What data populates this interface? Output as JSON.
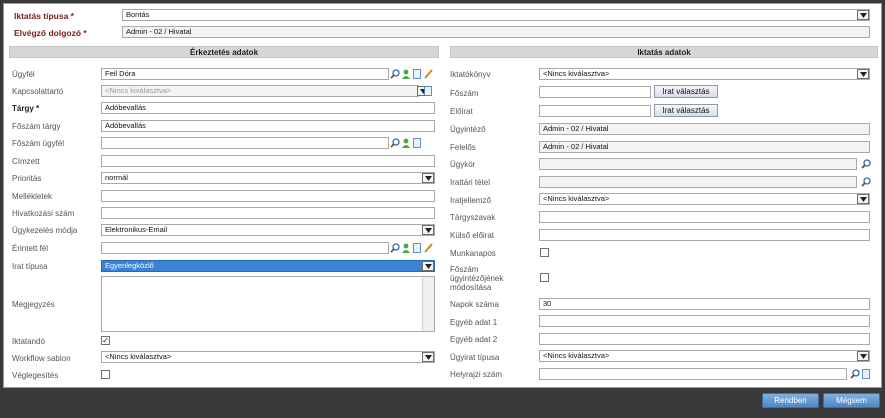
{
  "top": {
    "iktatas_tipusa_label": "Iktatás típusa *",
    "iktatas_tipusa_value": "Bontás",
    "elvegzo_label": "Elvégző dolgozó *",
    "elvegzo_value": "Admin - 02 / Hivatal"
  },
  "left": {
    "header": "Érkeztetés adatok",
    "ugyfel_label": "Ügyfél",
    "ugyfel_value": "Feil Dóra",
    "kapcsolattarto_label": "Kapcsolattartó",
    "kapcsolattarto_placeholder": "<Nincs kiválasztva>",
    "targy_label": "Tárgy *",
    "targy_value": "Adóbevallás",
    "foszam_targy_label": "Főszám tárgy",
    "foszam_targy_value": "Adóbevallás",
    "foszam_ugyfel_label": "Főszám ügyfél",
    "foszam_ugyfel_value": "",
    "cimzett_label": "Címzett",
    "cimzett_value": "",
    "prioritas_label": "Prioritás",
    "prioritas_value": "normál",
    "mellekletek_label": "Mellékletek",
    "hivatkozasi_label": "Hivatkozási szám",
    "ugykezeles_label": "Ügykezelés módja",
    "ugykezeles_value": "Elektronikus-Email",
    "erintett_label": "Érintett fél",
    "erintett_value": "",
    "irat_tipusa_label": "Irat típusa",
    "irat_tipusa_value": "Egyenlegközlő",
    "megjegyzes_label": "Megjegyzés",
    "iktatando_label": "Iktatandó",
    "iktatando_checked": "✓",
    "workflow_label": "Workflow sablon",
    "workflow_value": "<Nincs kiválasztva>",
    "veglegesites_label": "Véglegesítés"
  },
  "right": {
    "header": "Iktatás adatok",
    "iktatokonyv_label": "Iktatókönyv",
    "iktatokonyv_value": "<Nincs kiválasztva>",
    "foszam_label": "Főszám",
    "foszam_button": "Irat választás",
    "eloirat_label": "Előirat",
    "eloirat_button": "Irat választás",
    "ugyintezo_label": "Ügyintéző",
    "ugyintezo_value": "Admin - 02 / Hivatal",
    "felelos_label": "Felelős",
    "felelos_value": "Admin - 02 / Hivatal",
    "ugykor_label": "Ügykör",
    "irattari_label": "Irattári tétel",
    "iratjellemzo_label": "Iratjellemző",
    "iratjellemzo_value": "<Nincs kiválasztva>",
    "targyszavak_label": "Tárgyszavak",
    "kulso_eloirat_label": "Külső előirat",
    "munkanapos_label": "Munkanapos",
    "foszam_mod_label_1": "Főszám",
    "foszam_mod_label_2": "ügyintézőjének",
    "foszam_mod_label_3": "módosítása",
    "napok_label": "Napok száma",
    "napok_value": "30",
    "egyeb1_label": "Egyéb adat 1",
    "egyeb2_label": "Egyéb adat 2",
    "ugyirat_tipusa_label": "Ügyirat típusa",
    "ugyirat_tipusa_value": "<Nincs kiválasztva>",
    "helyrajzi_label": "Helyrajzi szám"
  },
  "footer": {
    "ok_label": "Rendben",
    "cancel_label": "Mégsem"
  },
  "colors": {
    "background": "#3a3a3a",
    "required_label": "#7a2020",
    "highlight": "#3a82d6",
    "button_blue": "#4f86c4"
  },
  "icons": [
    "search-icon",
    "add-user-icon",
    "document-icon",
    "edit-icon",
    "chevron-down-icon"
  ]
}
